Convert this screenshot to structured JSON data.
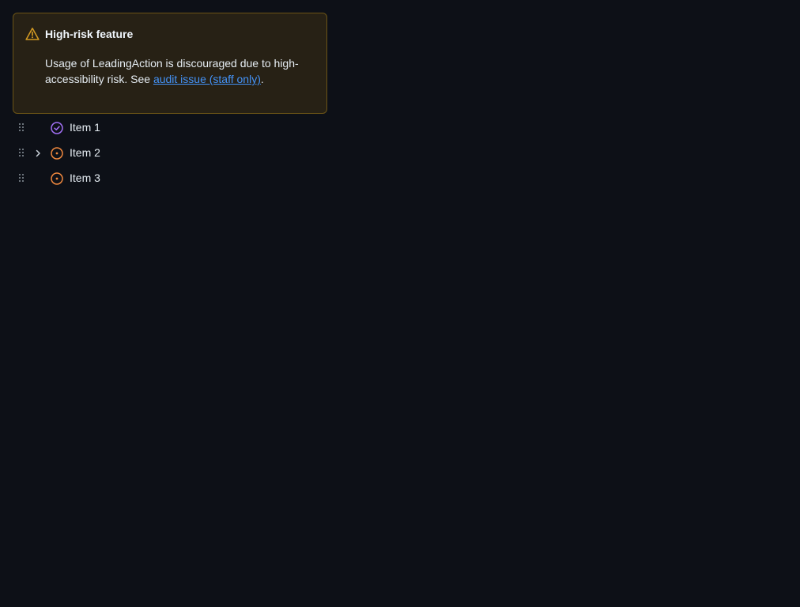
{
  "banner": {
    "title": "High-risk feature",
    "body_prefix": "Usage of LeadingAction is discouraged due to high-accessibility risk. See ",
    "link_text": "audit issue (staff only)",
    "body_suffix": ".",
    "icon": "alert-icon",
    "colors": {
      "background": "#272115",
      "border": "#6b5416",
      "icon": "#d29922",
      "link": "#4493f8"
    }
  },
  "tree": {
    "items": [
      {
        "label": "Item 1",
        "status_icon": "check-circle-icon",
        "status_color": "#a371f7",
        "expandable": false
      },
      {
        "label": "Item 2",
        "status_icon": "issue-open-icon",
        "status_color": "#f0883e",
        "expandable": true
      },
      {
        "label": "Item 3",
        "status_icon": "issue-open-icon",
        "status_color": "#f0883e",
        "expandable": false
      }
    ]
  }
}
